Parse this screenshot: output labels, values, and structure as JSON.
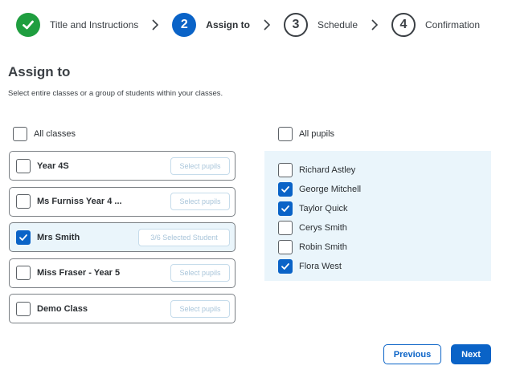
{
  "stepper": {
    "steps": [
      {
        "number": "",
        "label": "Title and Instructions",
        "state": "done",
        "icon": "check-icon"
      },
      {
        "number": "2",
        "label": "Assign to",
        "state": "active"
      },
      {
        "number": "3",
        "label": "Schedule",
        "state": "todo"
      },
      {
        "number": "4",
        "label": "Confirmation",
        "state": "todo"
      }
    ]
  },
  "page": {
    "title": "Assign to",
    "subtitle": "Select entire classes or a group of students within your classes."
  },
  "classes": {
    "all_label": "All classes",
    "all_checked": false,
    "items": [
      {
        "name": "Year 4S",
        "checked": false,
        "button": "Select pupils"
      },
      {
        "name": "Ms Furniss Year 4 ...",
        "checked": false,
        "button": "Select pupils"
      },
      {
        "name": "Mrs Smith",
        "checked": true,
        "button": "3/6 Selected Student"
      },
      {
        "name": "Miss Fraser - Year 5",
        "checked": false,
        "button": "Select pupils"
      },
      {
        "name": "Demo Class",
        "checked": false,
        "button": "Select pupils"
      }
    ]
  },
  "pupils": {
    "all_label": "All pupils",
    "all_checked": false,
    "items": [
      {
        "name": "Richard Astley",
        "checked": false
      },
      {
        "name": "George Mitchell",
        "checked": true
      },
      {
        "name": "Taylor Quick",
        "checked": true
      },
      {
        "name": "Cerys Smith",
        "checked": false
      },
      {
        "name": "Robin Smith",
        "checked": false
      },
      {
        "name": "Flora West",
        "checked": true
      }
    ]
  },
  "actions": {
    "previous_label": "Previous",
    "next_label": "Next"
  },
  "colors": {
    "primary": "#0a63c7",
    "success": "#1f9e3f",
    "selected_bg": "#eaf5fb"
  }
}
